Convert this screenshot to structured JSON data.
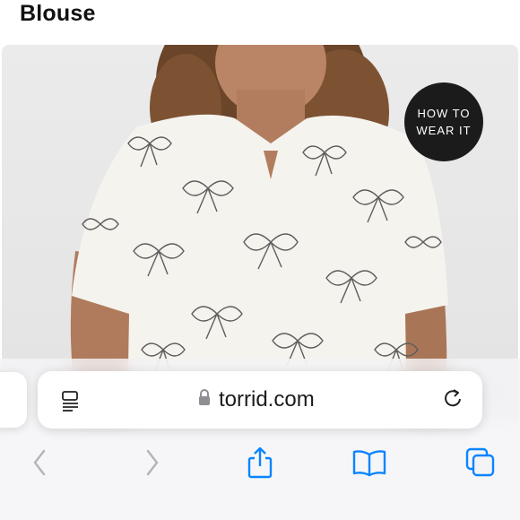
{
  "page": {
    "title": "Blouse"
  },
  "product_image": {
    "badge_line1": "HOW TO",
    "badge_line2": "WEAR IT"
  },
  "browser": {
    "url_domain": "torrid.com",
    "icons": {
      "reader": "reader-mode-icon",
      "lock": "lock-icon",
      "reload": "reload-icon",
      "back": "back-chevron-icon",
      "forward": "forward-chevron-icon",
      "share": "share-icon",
      "bookmarks": "bookmarks-book-icon",
      "tabs": "tabs-icon"
    },
    "colors": {
      "accent": "#0a84ff",
      "disabled": "#b5b5b9"
    }
  }
}
